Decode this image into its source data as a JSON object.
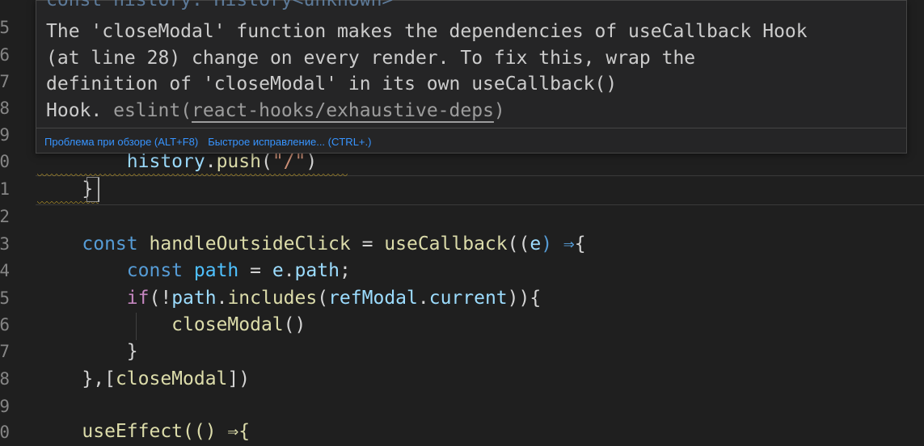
{
  "gutter": {
    "line_numbers": [
      "5",
      "6",
      "7",
      "8",
      "9",
      "0",
      "1",
      "2",
      "3",
      "4",
      "5",
      "6",
      "7",
      "8",
      "9",
      "0"
    ]
  },
  "hover": {
    "peek_text": "const history: History<unknown>",
    "message": "The 'closeModal' function makes the dependencies of useCallback Hook\n(at line 28) change on every render. To fix this, wrap the\ndefinition of 'closeModal' in its own useCallback()\nHook.",
    "source": "eslint(",
    "rule": "react-hooks/exhaustive-deps",
    "source_end": ")",
    "actions": {
      "view_problem": "Проблема при обзоре (ALT+F8)",
      "quick_fix": "Быстрое исправление... (CTRL+.)"
    }
  },
  "code": {
    "l10": {
      "indent": "        ",
      "obj": "history",
      "dot": ".",
      "fn": "push",
      "open": "(",
      "str": "\"/\"",
      "close": ")"
    },
    "l11": {
      "indent": "    ",
      "brace": "}"
    },
    "l13": {
      "indent": "    ",
      "kw": "const",
      "name": "handleOutsideClick",
      "eq": " = ",
      "fn": "useCallback",
      "open": "((",
      "param": "e",
      "arrow": ") ⇒",
      "brace": "{"
    },
    "l14": {
      "indent": "        ",
      "kw": "const",
      "name": "path",
      "eq": " = ",
      "obj": "e",
      "dot": ".",
      "prop": "path",
      "semi": ";"
    },
    "l15": {
      "indent": "        ",
      "kw": "if",
      "open": "(!",
      "obj": "path",
      "dot": ".",
      "fn": "includes",
      "open2": "(",
      "obj2": "refModal",
      "dot2": ".",
      "prop": "current",
      "close": ")){"
    },
    "l16": {
      "indent": "            ",
      "fn": "closeModal",
      "call": "()"
    },
    "l17": {
      "indent": "        ",
      "brace": "}"
    },
    "l18": {
      "indent": "    ",
      "close": "},[",
      "dep": "closeModal",
      "end": "])"
    },
    "l20": {
      "indent": "    ",
      "partial": "useEffect(() ⇒{"
    }
  },
  "colors": {
    "background": "#1f1f1f",
    "keyword": "#569cd6",
    "control": "#c586c0",
    "function": "#dcdcaa",
    "variable": "#9cdcfe",
    "string": "#ce9178",
    "link": "#3794ff",
    "warning": "#c9a42a"
  }
}
